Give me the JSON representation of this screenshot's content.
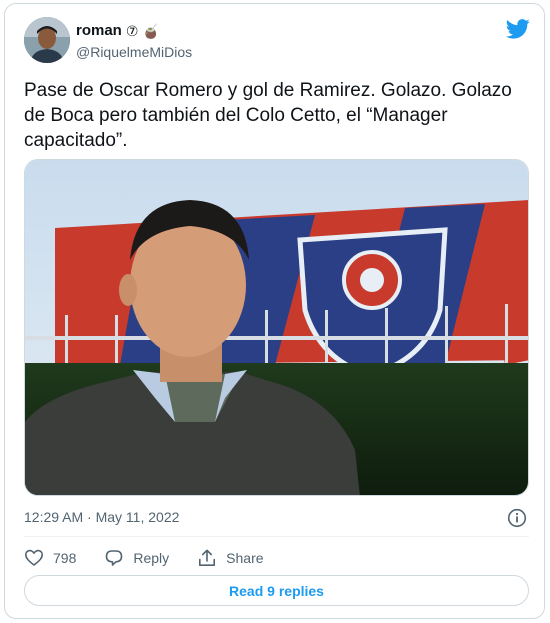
{
  "author": {
    "display_name": "roman",
    "name_emojis": "⑦ 🧉",
    "handle": "@RiquelmeMiDios"
  },
  "tweet": {
    "text": "Pase de Oscar Romero y gol de Ramirez. Golazo. Golazo de Boca pero también del Colo Cetto, el “Manager capacitado”.",
    "timestamp": "12:29 AM · May 11, 2022"
  },
  "metrics": {
    "likes": "798",
    "reply_label": "Reply",
    "share_label": "Share"
  },
  "read_replies_label": "Read 9 replies",
  "icons": {
    "brand": "twitter-bird-icon",
    "info": "info-icon",
    "like": "heart-icon",
    "reply": "reply-bubble-icon",
    "share": "share-icon"
  },
  "colors": {
    "accent": "#1d9bf0",
    "secondary_text": "#536471",
    "border": "#cfd9de"
  }
}
